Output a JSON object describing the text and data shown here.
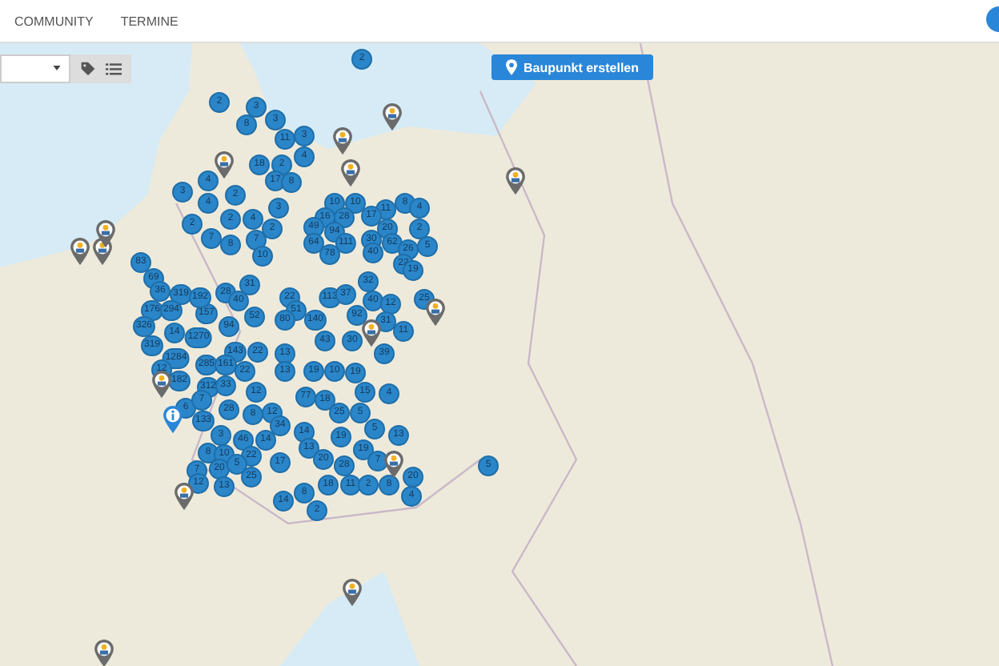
{
  "nav": {
    "items": [
      {
        "label": "COMMUNITY"
      },
      {
        "label": "TERMINE"
      }
    ]
  },
  "toolbar": {
    "create_button": "Baupunkt erstellen"
  },
  "markers": [
    {
      "kind": "cluster",
      "label": "2"
    },
    {
      "kind": "cluster",
      "label": "2"
    },
    {
      "kind": "cluster",
      "label": "3"
    },
    {
      "kind": "cluster",
      "label": "8"
    },
    {
      "kind": "cluster",
      "label": "3"
    },
    {
      "kind": "cluster",
      "label": "11"
    },
    {
      "kind": "cluster",
      "label": "3"
    },
    {
      "kind": "cluster",
      "label": "4"
    },
    {
      "kind": "cluster",
      "label": "18"
    },
    {
      "kind": "cluster",
      "label": "2"
    },
    {
      "kind": "cluster",
      "label": "17"
    },
    {
      "kind": "cluster",
      "label": "8"
    },
    {
      "kind": "cluster",
      "label": "3"
    },
    {
      "kind": "cluster",
      "label": "4"
    },
    {
      "kind": "cluster",
      "label": "4"
    },
    {
      "kind": "cluster",
      "label": "2"
    },
    {
      "kind": "cluster",
      "label": "3"
    },
    {
      "kind": "cluster",
      "label": "2"
    },
    {
      "kind": "cluster",
      "label": "2"
    },
    {
      "kind": "cluster",
      "label": "4"
    },
    {
      "kind": "cluster",
      "label": "2"
    },
    {
      "kind": "cluster",
      "label": "7"
    },
    {
      "kind": "cluster",
      "label": "8"
    },
    {
      "kind": "cluster",
      "label": "7"
    },
    {
      "kind": "cluster",
      "label": "10"
    },
    {
      "kind": "cluster",
      "label": "10"
    },
    {
      "kind": "cluster",
      "label": "10"
    },
    {
      "kind": "cluster",
      "label": "11"
    },
    {
      "kind": "cluster",
      "label": "8"
    },
    {
      "kind": "cluster",
      "label": "4"
    },
    {
      "kind": "cluster",
      "label": "16"
    },
    {
      "kind": "cluster",
      "label": "28"
    },
    {
      "kind": "cluster",
      "label": "17"
    },
    {
      "kind": "cluster",
      "label": "94"
    },
    {
      "kind": "cluster",
      "label": "49"
    },
    {
      "kind": "cluster",
      "label": "64"
    },
    {
      "kind": "cluster",
      "label": "111"
    },
    {
      "kind": "cluster",
      "label": "78"
    },
    {
      "kind": "cluster",
      "label": "30"
    },
    {
      "kind": "cluster",
      "label": "20"
    },
    {
      "kind": "cluster",
      "label": "2"
    },
    {
      "kind": "cluster",
      "label": "62"
    },
    {
      "kind": "cluster",
      "label": "5"
    },
    {
      "kind": "cluster",
      "label": "40"
    },
    {
      "kind": "cluster",
      "label": "26"
    },
    {
      "kind": "cluster",
      "label": "22"
    },
    {
      "kind": "cluster",
      "label": "83"
    },
    {
      "kind": "cluster",
      "label": "69"
    },
    {
      "kind": "cluster",
      "label": "36"
    },
    {
      "kind": "cluster",
      "label": "319"
    },
    {
      "kind": "cluster",
      "label": "176"
    },
    {
      "kind": "cluster",
      "label": "294"
    },
    {
      "kind": "cluster",
      "label": "326"
    },
    {
      "kind": "cluster",
      "label": "14"
    },
    {
      "kind": "cluster",
      "label": "319"
    },
    {
      "kind": "cluster",
      "label": "1284"
    },
    {
      "kind": "cluster",
      "label": "1270"
    },
    {
      "kind": "cluster",
      "label": "157"
    },
    {
      "kind": "cluster",
      "label": "192"
    },
    {
      "kind": "cluster",
      "label": "28"
    },
    {
      "kind": "cluster",
      "label": "31"
    },
    {
      "kind": "cluster",
      "label": "94"
    },
    {
      "kind": "cluster",
      "label": "143"
    },
    {
      "kind": "cluster",
      "label": "52"
    },
    {
      "kind": "cluster",
      "label": "40"
    },
    {
      "kind": "cluster",
      "label": "22"
    },
    {
      "kind": "cluster",
      "label": "51"
    },
    {
      "kind": "cluster",
      "label": "80"
    },
    {
      "kind": "cluster",
      "label": "140"
    },
    {
      "kind": "cluster",
      "label": "92"
    },
    {
      "kind": "cluster",
      "label": "113"
    },
    {
      "kind": "cluster",
      "label": "37"
    },
    {
      "kind": "cluster",
      "label": "32"
    },
    {
      "kind": "cluster",
      "label": "40"
    },
    {
      "kind": "cluster",
      "label": "12"
    },
    {
      "kind": "cluster",
      "label": "19"
    },
    {
      "kind": "cluster",
      "label": "25"
    },
    {
      "kind": "cluster",
      "label": "31"
    },
    {
      "kind": "cluster",
      "label": "22"
    },
    {
      "kind": "cluster",
      "label": "13"
    },
    {
      "kind": "cluster",
      "label": "43"
    },
    {
      "kind": "cluster",
      "label": "30"
    },
    {
      "kind": "cluster",
      "label": "39"
    },
    {
      "kind": "cluster",
      "label": "11"
    },
    {
      "kind": "cluster",
      "label": "133"
    },
    {
      "kind": "cluster",
      "label": "3"
    },
    {
      "kind": "cluster",
      "label": "46"
    },
    {
      "kind": "cluster",
      "label": "14"
    },
    {
      "kind": "cluster",
      "label": "8"
    },
    {
      "kind": "cluster",
      "label": "10"
    },
    {
      "kind": "cluster",
      "label": "22"
    },
    {
      "kind": "cluster",
      "label": "7"
    },
    {
      "kind": "cluster",
      "label": "20"
    },
    {
      "kind": "cluster",
      "label": "5"
    },
    {
      "kind": "cluster",
      "label": "12"
    },
    {
      "kind": "cluster",
      "label": "13"
    },
    {
      "kind": "cluster",
      "label": "25"
    },
    {
      "kind": "cluster",
      "label": "17"
    },
    {
      "kind": "cluster",
      "label": "14"
    },
    {
      "kind": "cluster",
      "label": "13"
    },
    {
      "kind": "cluster",
      "label": "20"
    },
    {
      "kind": "cluster",
      "label": "19"
    },
    {
      "kind": "cluster",
      "label": "28"
    },
    {
      "kind": "cluster",
      "label": "19"
    },
    {
      "kind": "cluster",
      "label": "7"
    },
    {
      "kind": "cluster",
      "label": "5"
    },
    {
      "kind": "cluster",
      "label": "13"
    },
    {
      "kind": "cluster",
      "label": "14"
    },
    {
      "kind": "cluster",
      "label": "8"
    },
    {
      "kind": "cluster",
      "label": "18"
    },
    {
      "kind": "cluster",
      "label": "11"
    },
    {
      "kind": "cluster",
      "label": "2"
    },
    {
      "kind": "cluster",
      "label": "8"
    },
    {
      "kind": "cluster",
      "label": "20"
    },
    {
      "kind": "cluster",
      "label": "4"
    },
    {
      "kind": "cluster",
      "label": "2"
    },
    {
      "kind": "cluster",
      "label": "5"
    },
    {
      "kind": "cluster",
      "label": "12"
    },
    {
      "kind": "cluster",
      "label": "182"
    },
    {
      "kind": "cluster",
      "label": "285"
    },
    {
      "kind": "cluster",
      "label": "312"
    },
    {
      "kind": "cluster",
      "label": "161"
    },
    {
      "kind": "cluster",
      "label": "33"
    },
    {
      "kind": "cluster",
      "label": "22"
    },
    {
      "kind": "cluster",
      "label": "12"
    },
    {
      "kind": "cluster",
      "label": "13"
    },
    {
      "kind": "cluster",
      "label": "19"
    },
    {
      "kind": "cluster",
      "label": "10"
    },
    {
      "kind": "cluster",
      "label": "19"
    },
    {
      "kind": "cluster",
      "label": "15"
    },
    {
      "kind": "cluster",
      "label": "4"
    },
    {
      "kind": "cluster",
      "label": "6"
    },
    {
      "kind": "cluster",
      "label": "7"
    },
    {
      "kind": "cluster",
      "label": "28"
    },
    {
      "kind": "cluster",
      "label": "8"
    },
    {
      "kind": "cluster",
      "label": "12"
    },
    {
      "kind": "cluster",
      "label": "34"
    },
    {
      "kind": "cluster",
      "label": "77"
    },
    {
      "kind": "cluster",
      "label": "18"
    },
    {
      "kind": "cluster",
      "label": "25"
    },
    {
      "kind": "cluster",
      "label": "5"
    },
    {
      "kind": "pin"
    },
    {
      "kind": "pin"
    },
    {
      "kind": "pin"
    },
    {
      "kind": "pin"
    },
    {
      "kind": "pin"
    },
    {
      "kind": "pin"
    },
    {
      "kind": "pin"
    },
    {
      "kind": "pin"
    },
    {
      "kind": "pin"
    },
    {
      "kind": "pin"
    },
    {
      "kind": "pin"
    },
    {
      "kind": "pin"
    },
    {
      "kind": "pin"
    },
    {
      "kind": "pin"
    },
    {
      "kind": "pin"
    },
    {
      "kind": "info"
    }
  ]
}
